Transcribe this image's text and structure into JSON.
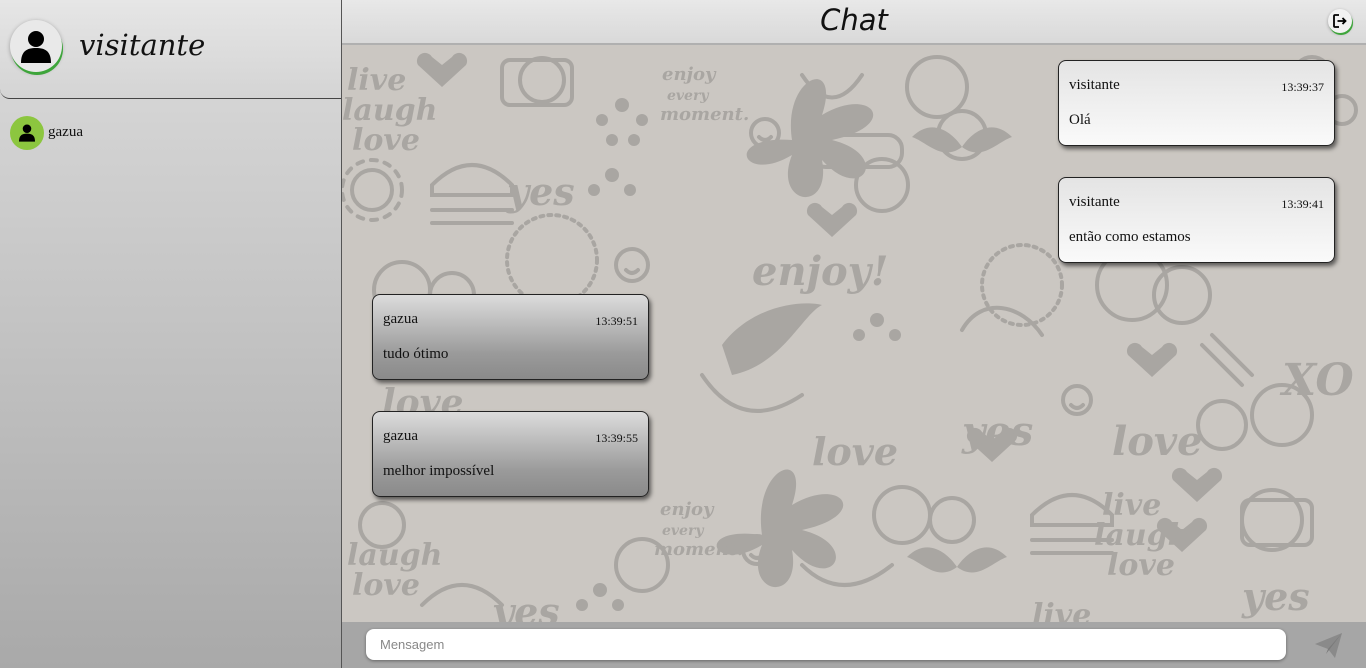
{
  "sidebar": {
    "current_user": {
      "name": "visitante",
      "icon": "user-icon"
    },
    "contacts": [
      {
        "name": "gazua",
        "icon": "user-icon",
        "avatar_color": "#8cc63f"
      }
    ]
  },
  "header": {
    "title": "Chat",
    "logout_icon": "logout-icon"
  },
  "messages": [
    {
      "sender": "visitante",
      "time": "13:39:37",
      "text": "Olá",
      "direction": "out"
    },
    {
      "sender": "visitante",
      "time": "13:39:41",
      "text": "então como estamos",
      "direction": "out"
    },
    {
      "sender": "gazua",
      "time": "13:39:51",
      "text": "tudo ótimo",
      "direction": "in"
    },
    {
      "sender": "gazua",
      "time": "13:39:55",
      "text": "melhor impossível",
      "direction": "in"
    }
  ],
  "composer": {
    "placeholder": "Mensagem",
    "value": "",
    "send_icon": "send-icon"
  },
  "colors": {
    "accent_green": "#3ea53b",
    "contact_avatar": "#8cc63f",
    "chat_background": "#cbc7c2"
  }
}
